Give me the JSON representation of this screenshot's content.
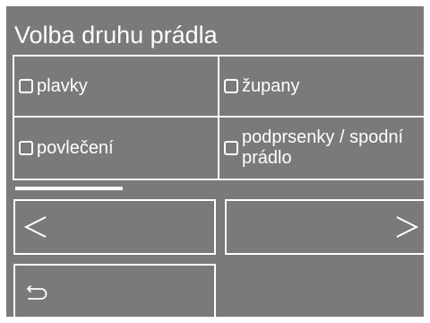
{
  "header": {
    "title": "Volba druhu prádla"
  },
  "options": [
    {
      "label": "plavky",
      "checked": false
    },
    {
      "label": "župany",
      "checked": false
    },
    {
      "label": "povlečení",
      "checked": false
    },
    {
      "label": "podprsenky / spodní prádlo",
      "checked": false
    }
  ],
  "navigation": {
    "prev_icon": "chevron-left-icon",
    "next_icon": "chevron-right-icon",
    "back_icon": "back-arrow-icon"
  },
  "colors": {
    "screen_background": "#7a7a7a",
    "foreground": "#ffffff"
  }
}
